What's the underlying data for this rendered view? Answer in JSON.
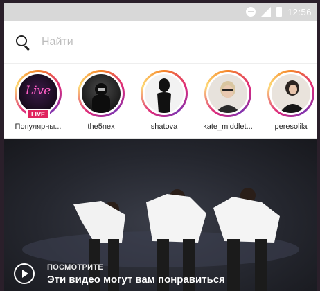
{
  "status_bar": {
    "time": "12:56",
    "icons": [
      "do-not-disturb-icon",
      "signal-icon",
      "battery-icon"
    ]
  },
  "search": {
    "placeholder": "Найти",
    "icon": "search-icon"
  },
  "stories": [
    {
      "label": "Популярны...",
      "live": true,
      "live_badge": "LIVE",
      "cover_text": "Live"
    },
    {
      "label": "the5nex"
    },
    {
      "label": "shatova"
    },
    {
      "label": "kate_middlet..."
    },
    {
      "label": "peresolila"
    }
  ],
  "video": {
    "kicker": "ПОСМОТРИТЕ",
    "title": "Эти видео могут вам понравиться",
    "icon": "play-icon"
  },
  "colors": {
    "story_ring_start": "#f58529",
    "story_ring_mid": "#dd2a7b",
    "live_badge": "#e0245e"
  }
}
